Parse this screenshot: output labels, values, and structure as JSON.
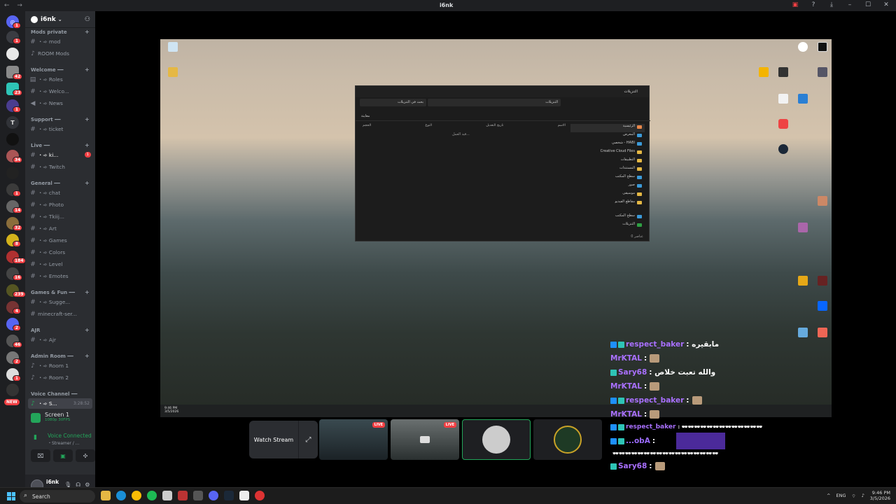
{
  "window": {
    "title": "i6nk"
  },
  "server": {
    "name": "i6nk"
  },
  "channels": {
    "categories": [
      {
        "label": "Mods private"
      },
      {
        "label": "Welcome ━━"
      },
      {
        "label": "Support ━━"
      },
      {
        "label": "Live ━━"
      },
      {
        "label": "General ━━"
      },
      {
        "label": "Games & Fun ━━"
      },
      {
        "label": "AJR"
      },
      {
        "label": "Admin Room ━━"
      },
      {
        "label": "Voice Channel ━━"
      }
    ],
    "items": [
      {
        "label": "・➾ mod"
      },
      {
        "label": "ROOM Mods"
      },
      {
        "label": "・➾ Roles"
      },
      {
        "label": "・➾ Welco..."
      },
      {
        "label": "・➾ News"
      },
      {
        "label": "・➾ ticket"
      },
      {
        "label": "・➾ ki...",
        "badge": "1"
      },
      {
        "label": "・➾ Twitch"
      },
      {
        "label": "・➾ chat"
      },
      {
        "label": "・➾ Photo"
      },
      {
        "label": "・➾ Tkiij..."
      },
      {
        "label": "・➾ Art"
      },
      {
        "label": "・➾ Games"
      },
      {
        "label": "・➾ Colors"
      },
      {
        "label": "・➾ Level"
      },
      {
        "label": "・➾ Emotes"
      },
      {
        "label": "・➾ Sugge..."
      },
      {
        "label": "minecraft-ser..."
      },
      {
        "label": "・➾ Ajr"
      },
      {
        "label": "・➾ Room 1"
      },
      {
        "label": "・➾ Room 2"
      },
      {
        "label": "・➾ S...",
        "timer": "3:28:52"
      }
    ]
  },
  "rail": {
    "badges": [
      "1",
      "1",
      "42",
      "23",
      "1",
      "34",
      "1",
      "14",
      "32",
      "8",
      "184",
      "16",
      "239",
      "4",
      "2",
      "46",
      "2",
      "1"
    ],
    "new_label": "NEW"
  },
  "voice": {
    "screen_title": "Screen 1",
    "screen_quality": "1080p 30FPS",
    "connected_label": "Voice Connected",
    "connected_sub": "・Streamer / ..."
  },
  "user": {
    "name": "i6nk"
  },
  "explorer": {
    "tab_title": "التنزيلات",
    "address": "التنزيلات",
    "search_placeholder": "بحث في التنزيلات",
    "columns": [
      "الاسم",
      "تاريخ التعديل",
      "النوع",
      "الحجم"
    ],
    "empty_text": "قيد العمل...",
    "nav": [
      {
        "label": "الرئيسية",
        "sel": true
      },
      {
        "label": "المعرض"
      },
      {
        "label": "شخصي - HABI"
      },
      {
        "label": "Creative Cloud Files"
      },
      {
        "label": "التطبيقات"
      },
      {
        "label": "المستندات"
      },
      {
        "label": "سطح المكتب"
      },
      {
        "label": "صور"
      },
      {
        "label": "موسيقى"
      },
      {
        "label": "مقاطع الفيديو"
      },
      {
        "label": "سطح المكتب"
      },
      {
        "label": "التنزيلات"
      }
    ],
    "footer": "0 عناصر",
    "details_label": "معاينة"
  },
  "stream_clock": {
    "time": "9:46 PM",
    "date": "3/5/2026"
  },
  "chat": [
    {
      "name": "respect_baker",
      "text": "مابقيره",
      "badges": true
    },
    {
      "name": "MrKTAL",
      "text": "",
      "emote": true
    },
    {
      "name": "Sary68",
      "text": "والله تعبت خلاص",
      "badges": true
    },
    {
      "name": "MrKTAL",
      "text": "",
      "emote": true
    },
    {
      "name": "respect_baker",
      "text": "",
      "emote": true,
      "badges": true
    },
    {
      "name": "MrKTAL",
      "text": "",
      "emote": true
    },
    {
      "name": "respect_baker",
      "text": "🕶︎🕶︎🕶︎🕶︎🕶︎🕶︎🕶︎🕶︎🕶︎🕶︎🕶︎🕶︎🕶︎",
      "badges": true
    },
    {
      "name": "...obA",
      "text": "",
      "badges": true
    },
    {
      "name": "",
      "text": "🕶︎🕶︎🕶︎🕶︎🕶︎🕶︎🕶︎🕶︎🕶︎🕶︎🕶︎🕶︎🕶︎🕶︎🕶︎🕶︎🕶︎"
    },
    {
      "name": "Sary68",
      "text": "",
      "emote": true,
      "badges": true
    }
  ],
  "stream_controls": {
    "watch_label": "Watch Stream",
    "live_label": "LIVE"
  },
  "taskbar": {
    "search_placeholder": "Search",
    "lang": "ENG",
    "time": "9:46 PM",
    "date": "3/5/2026"
  },
  "colors": {
    "accent_green": "#23a55a",
    "danger_red": "#f23f43",
    "chat_name": "#a970ff"
  }
}
